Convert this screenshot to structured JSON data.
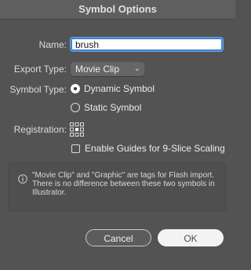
{
  "dialog": {
    "title": "Symbol Options"
  },
  "name": {
    "label": "Name:",
    "value": "brush"
  },
  "export_type": {
    "label": "Export Type:",
    "selected": "Movie Clip"
  },
  "symbol_type": {
    "label": "Symbol Type:",
    "options": [
      {
        "label": "Dynamic Symbol",
        "selected": true
      },
      {
        "label": "Static Symbol",
        "selected": false
      }
    ]
  },
  "registration": {
    "label": "Registration:",
    "selected_point": "center"
  },
  "guides": {
    "label": "Enable Guides for 9-Slice Scaling",
    "checked": false
  },
  "info": {
    "icon": "info-icon",
    "text": "\"Movie Clip\" and \"Graphic\" are tags for Flash import. There is no difference between these two symbols in Illustrator."
  },
  "buttons": {
    "cancel": "Cancel",
    "ok": "OK"
  },
  "colors": {
    "background": "#535353",
    "focus": "#3d83d6"
  }
}
